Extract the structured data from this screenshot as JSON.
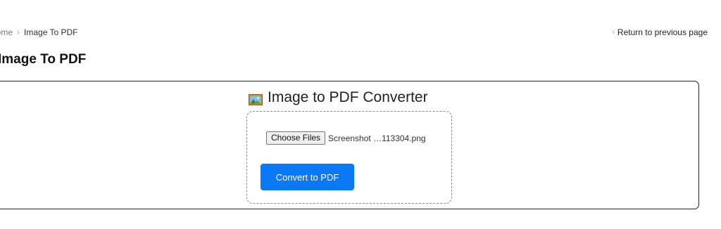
{
  "breadcrumb": {
    "home_label": "Home",
    "separator": "›",
    "current_label": "Image To PDF"
  },
  "return_link": {
    "chevron": "‹",
    "label": "Return to previous page"
  },
  "page_title": "Image To PDF",
  "converter": {
    "icon": "framed-picture-icon",
    "title": "Image to PDF Converter",
    "choose_button_label": "Choose Files",
    "selected_file": "Screenshot …113304.png",
    "convert_button_label": "Convert to PDF"
  },
  "colors": {
    "accent": "#0b79f5",
    "card_border": "#222222",
    "dropzone_border": "#888888"
  }
}
